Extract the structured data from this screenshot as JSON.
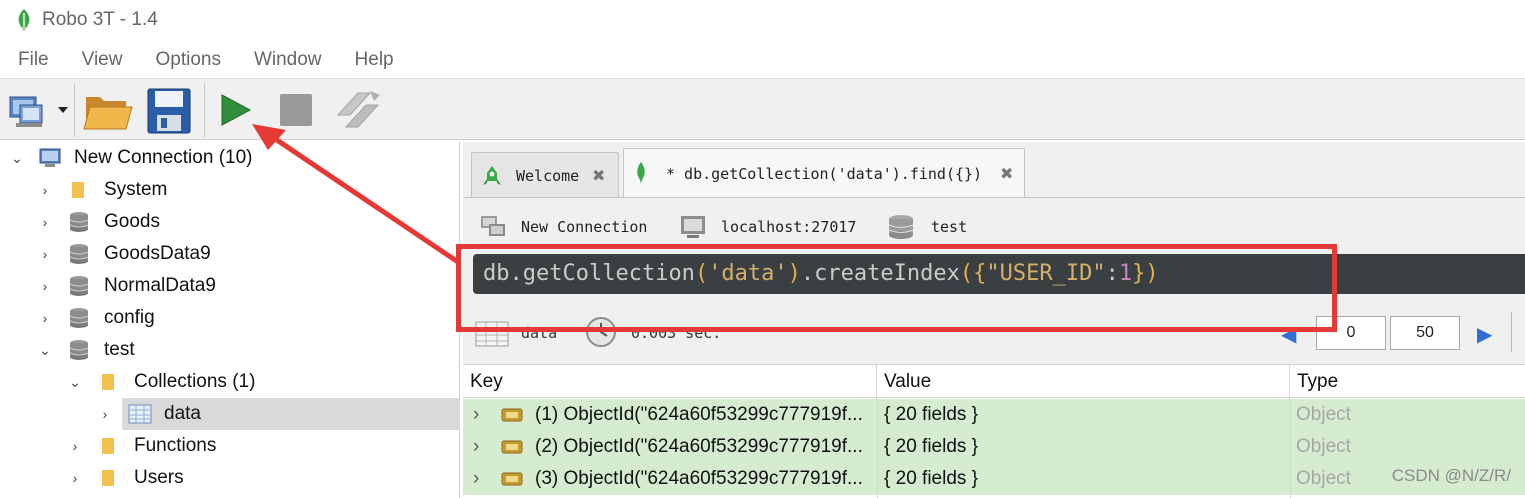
{
  "window": {
    "title": "Robo 3T - 1.4"
  },
  "menu": [
    "File",
    "View",
    "Options",
    "Window",
    "Help"
  ],
  "toolbar": {
    "connect": "connect-icon",
    "open": "folder-open-icon",
    "save": "save-icon",
    "run": "play-icon",
    "stop": "stop-icon",
    "format": "rotate-icon"
  },
  "tree": {
    "root": "New Connection (10)",
    "items": [
      "System",
      "Goods",
      "GoodsData9",
      "NormalData9",
      "config",
      "test"
    ],
    "test_children": {
      "collections": "Collections (1)",
      "collection_items": [
        "data"
      ],
      "functions": "Functions",
      "users": "Users"
    }
  },
  "tabs": [
    {
      "label": "Welcome"
    },
    {
      "label": "* db.getCollection('data').find({})"
    }
  ],
  "connection": {
    "name": "New Connection",
    "host": "localhost:27017",
    "db": "test"
  },
  "editor": {
    "t1": "db",
    "t2": ".getCollection",
    "t3": "(",
    "t4": "'data'",
    "t5": ")",
    "t6": ".createIndex",
    "t7": "({",
    "t8": "\"USER_ID\"",
    "t9": ":",
    "t10": "1",
    "t11": "})"
  },
  "result_bar": {
    "collection": "data",
    "time": "0.003 sec.",
    "skip": "0",
    "limit": "50"
  },
  "table": {
    "headers": [
      "Key",
      "Value",
      "Type"
    ],
    "rows": [
      {
        "key": "(1) ObjectId(\"624a60f53299c777919f...",
        "value": "{ 20 fields }",
        "type": "Object"
      },
      {
        "key": "(2) ObjectId(\"624a60f53299c777919f...",
        "value": "{ 20 fields }",
        "type": "Object"
      },
      {
        "key": "(3) ObjectId(\"624a60f53299c777919f...",
        "value": "{ 20 fields }",
        "type": "Object"
      }
    ]
  },
  "watermark": "CSDN @N/Z/R/",
  "colors": {
    "annotation": "#e53935",
    "row_bg": "#d5ecd1",
    "editor_bg": "#3a3f41"
  }
}
